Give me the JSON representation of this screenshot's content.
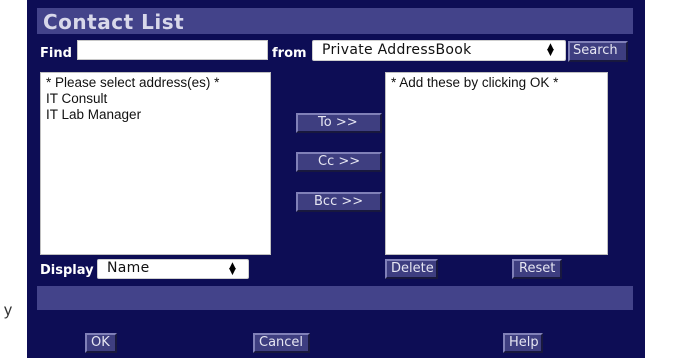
{
  "title": "Contact List",
  "find": {
    "label": "Find",
    "value": ""
  },
  "from": {
    "label": "from",
    "selected": "Private AddressBook",
    "search_label": "Search"
  },
  "source_list": {
    "items": [
      "* Please select address(es) *",
      "IT Consult",
      "IT Lab Manager"
    ]
  },
  "transfer": {
    "to": "To >>",
    "cc": "Cc >>",
    "bcc": "Bcc >>"
  },
  "target_list": {
    "items": [
      "* Add these by clicking OK *"
    ]
  },
  "display": {
    "label": "Display",
    "selected": "Name"
  },
  "actions": {
    "delete": "Delete",
    "reset": "Reset"
  },
  "footer": {
    "ok": "OK",
    "cancel": "Cancel",
    "help": "Help"
  },
  "background_fragment": "y",
  "colors": {
    "panel": "#0d0d55",
    "bar": "#43438a",
    "button": "#3e3e80"
  }
}
